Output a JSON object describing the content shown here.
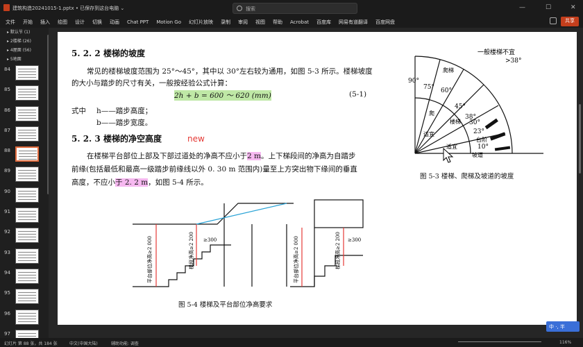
{
  "window": {
    "title": "建筑构造20241015-1.pptx  •  已保存到这台电脑  ⌄",
    "search_placeholder": "搜索"
  },
  "menu": [
    "文件",
    "开始",
    "插入",
    "绘图",
    "设计",
    "切换",
    "动画",
    "Chat PPT",
    "Motion Go",
    "幻灯片放映",
    "录制",
    "审阅",
    "视图",
    "帮助",
    "Acrobat",
    "百度库",
    "网易有道翻译",
    "百度网盘"
  ],
  "share_label": "共享",
  "sidebar": {
    "sections": [
      "▸ 默认节 (1)",
      "▸ 2楼梯 (26)",
      "▸ 4屋面 (56)",
      "▸ 5地面"
    ],
    "slides": [
      "84",
      "85",
      "86",
      "87",
      "88",
      "89",
      "90",
      "91",
      "92",
      "93",
      "94",
      "95",
      "96",
      "97"
    ],
    "selected": "88"
  },
  "slide": {
    "h1": "5. 2. 2    楼梯的坡度",
    "p1": "常见的楼梯坡度范围为 25°～45°，其中以 30°左右较为通用，如图 5-3 所示。楼梯坡度",
    "p2": "的大小与踏步的尺寸有关，一般按经验公式计算：",
    "formula": "2h + b = 600 ～ 620 (mm)",
    "formula_no": "(5-1)",
    "where": "式中",
    "h_def": "h——踏步高度；",
    "b_def": "b——踏步宽度。",
    "h2": "5. 2. 3    楼梯的净空高度",
    "new": "new",
    "p3a": "在楼梯平台部位上部及下部过道处的净高不应小于",
    "p3b": "2 m",
    "p3c": "。上下梯段间的净高为自踏步",
    "p4": "前缘(包括最低和最高一级踏步前缘线以外 0. 30 m 范围内)量至上方突出物下缘间的垂直",
    "p5a": "高度，不应小",
    "p5b": "于 2. 2 m",
    "p5c": "，如图 5-4 所示。",
    "fig3_caption": "图 5-3    楼梯、爬梯及坡道的坡度",
    "fig4_caption": "图 5-4    楼梯及平台部位净高要求",
    "fig3_labels": {
      "a": "一般楼梯不宜",
      "b": ">38°",
      "c": "90°",
      "d": "75°",
      "e": "60°",
      "f": "45°",
      "g": "38°",
      "h": "30°",
      "i": "23°",
      "j": "10°",
      "k": "爬梯",
      "l": "适宜",
      "m": "楼梯",
      "n": "适宜",
      "o": "台阶",
      "p": "坡道",
      "q": "爬"
    },
    "fig4_labels": {
      "a": "平台部位净高≥2 000",
      "b": "梯段净高≥2 200",
      "c": "≥300",
      "d": "平台部位净高≥2 000",
      "e": "梯段净高≥2 200",
      "f": "≥300"
    }
  },
  "status": {
    "slide": "幻灯片 第 88 张，共 184 张",
    "lang": "中文(中国大陆)",
    "access": "辅助功能: 调查",
    "zoom": "116%",
    "ime": "中  ·,  半"
  }
}
